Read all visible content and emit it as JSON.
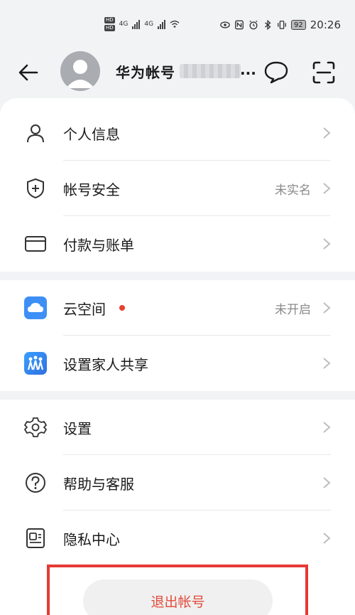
{
  "status_bar": {
    "hd_badge_1": "HD",
    "hd_badge_2": "HD",
    "network_1": "4G",
    "network_2": "4G",
    "battery": "92",
    "time": "20:26"
  },
  "header": {
    "account_name": "华为帐号",
    "ellipsis": "..."
  },
  "menu_groups": [
    [
      {
        "label": "个人信息",
        "value": ""
      },
      {
        "label": "帐号安全",
        "value": "未实名"
      },
      {
        "label": "付款与账单",
        "value": ""
      }
    ],
    [
      {
        "label": "云空间",
        "value": "未开启"
      },
      {
        "label": "设置家人共享",
        "value": ""
      }
    ],
    [
      {
        "label": "设置",
        "value": ""
      },
      {
        "label": "帮助与客服",
        "value": ""
      },
      {
        "label": "隐私中心",
        "value": ""
      }
    ]
  ],
  "logout": {
    "label": "退出帐号"
  },
  "colors": {
    "accent_red": "#e24a3a",
    "cloud_blue": "#3d8ff5",
    "highlight": "#e53935"
  }
}
